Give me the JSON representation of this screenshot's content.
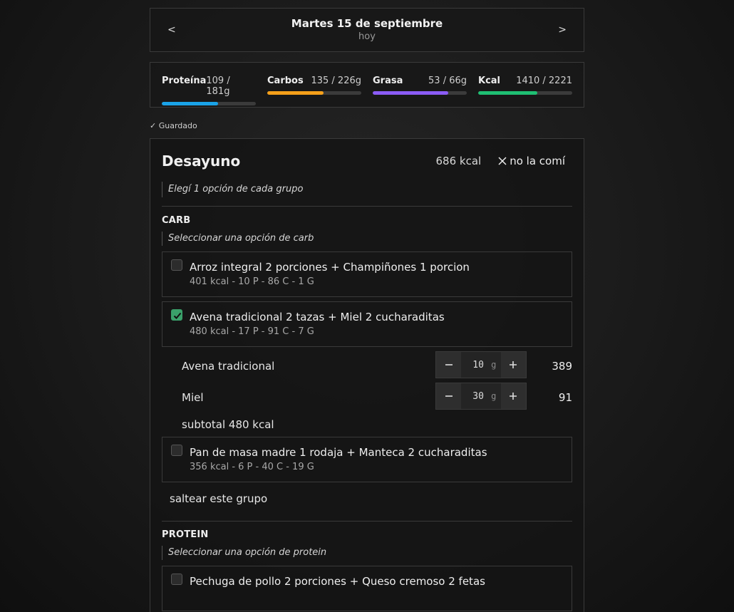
{
  "date_nav": {
    "prev_label": "<",
    "next_label": ">",
    "title": "Martes 15 de septiembre",
    "subtitle": "hoy"
  },
  "macros": [
    {
      "name": "Proteína",
      "value": "109 / 181g",
      "progress": 0.6,
      "color": "#1aa3e8"
    },
    {
      "name": "Carbos",
      "value": "135 / 226g",
      "progress": 0.6,
      "color": "#f5a01a"
    },
    {
      "name": "Grasa",
      "value": "53 / 66g",
      "progress": 0.8,
      "color": "#8b5cf6"
    },
    {
      "name": "Kcal",
      "value": "1410 / 2221",
      "progress": 0.63,
      "color": "#1fbf73"
    }
  ],
  "status": {
    "saved": "✓ Guardado"
  },
  "meal": {
    "title": "Desayuno",
    "kcal": "686 kcal",
    "skip_label": "no la comí",
    "instruction": "Elegí 1 opción de cada grupo"
  },
  "groups": [
    {
      "title": "CARB",
      "note": "Seleccionar una opción de carb",
      "options": [
        {
          "name": "Arroz integral 2 porciones + Champiñones 1 porcion",
          "macros": "401 kcal - 10 P - 86 C - 1 G",
          "checked": false
        },
        {
          "name": "Avena tradicional 2 tazas + Miel 2 cucharaditas",
          "macros": "480 kcal - 17 P - 91 C - 7 G",
          "checked": true
        },
        {
          "name": "Pan de masa madre 1 rodaja + Manteca 2 cucharaditas",
          "macros": "356 kcal - 6 P - 40 C - 19 G",
          "checked": false
        }
      ],
      "ingredients": [
        {
          "name": "Avena tradicional",
          "amount": "10",
          "unit": "g",
          "kcal": "389"
        },
        {
          "name": "Miel",
          "amount": "30",
          "unit": "g",
          "kcal": "91"
        }
      ],
      "subtotal": "subtotal 480 kcal",
      "skip_label": "saltear este grupo"
    },
    {
      "title": "PROTEIN",
      "note": "Seleccionar una opción de protein",
      "options": [
        {
          "name": "Pechuga de pollo 2 porciones + Queso cremoso 2 fetas",
          "macros": "",
          "checked": false
        }
      ]
    }
  ],
  "icons": {
    "close": "close-icon",
    "check": "check-icon",
    "minus": "minus-icon",
    "plus": "plus-icon"
  }
}
